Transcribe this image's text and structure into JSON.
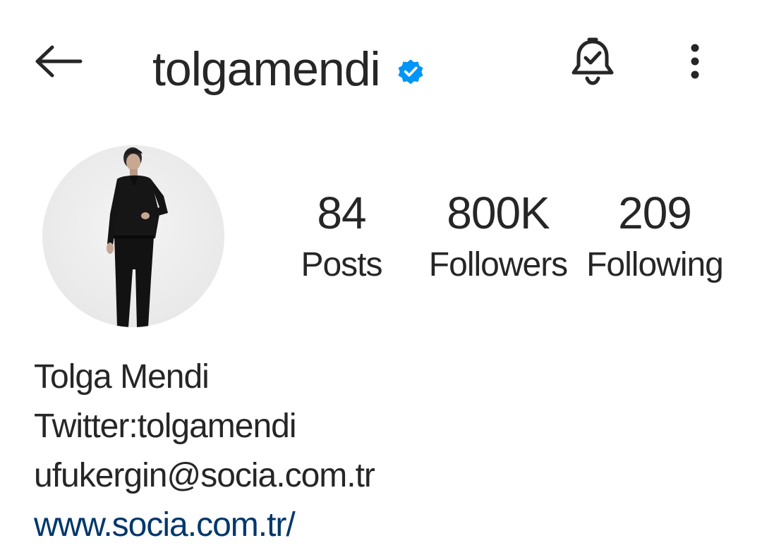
{
  "header": {
    "username": "tolgamendi",
    "icons": {
      "back": "arrow-left-icon",
      "verified": "verified-badge-icon",
      "notifications": "bell-check-icon",
      "more": "more-vertical-icon"
    }
  },
  "profile": {
    "avatar_icon": "profile-photo",
    "stats": [
      {
        "value": "84",
        "label": "Posts"
      },
      {
        "value": "800K",
        "label": "Followers"
      },
      {
        "value": "209",
        "label": "Following"
      }
    ]
  },
  "bio": {
    "name": "Tolga Mendi",
    "line1": "Twitter:tolgamendi",
    "line2": "ufukergin@socia.com.tr",
    "link": "www.socia.com.tr/"
  },
  "colors": {
    "text": "#262626",
    "verified": "#0095f6",
    "link": "#00376b",
    "background": "#ffffff"
  }
}
